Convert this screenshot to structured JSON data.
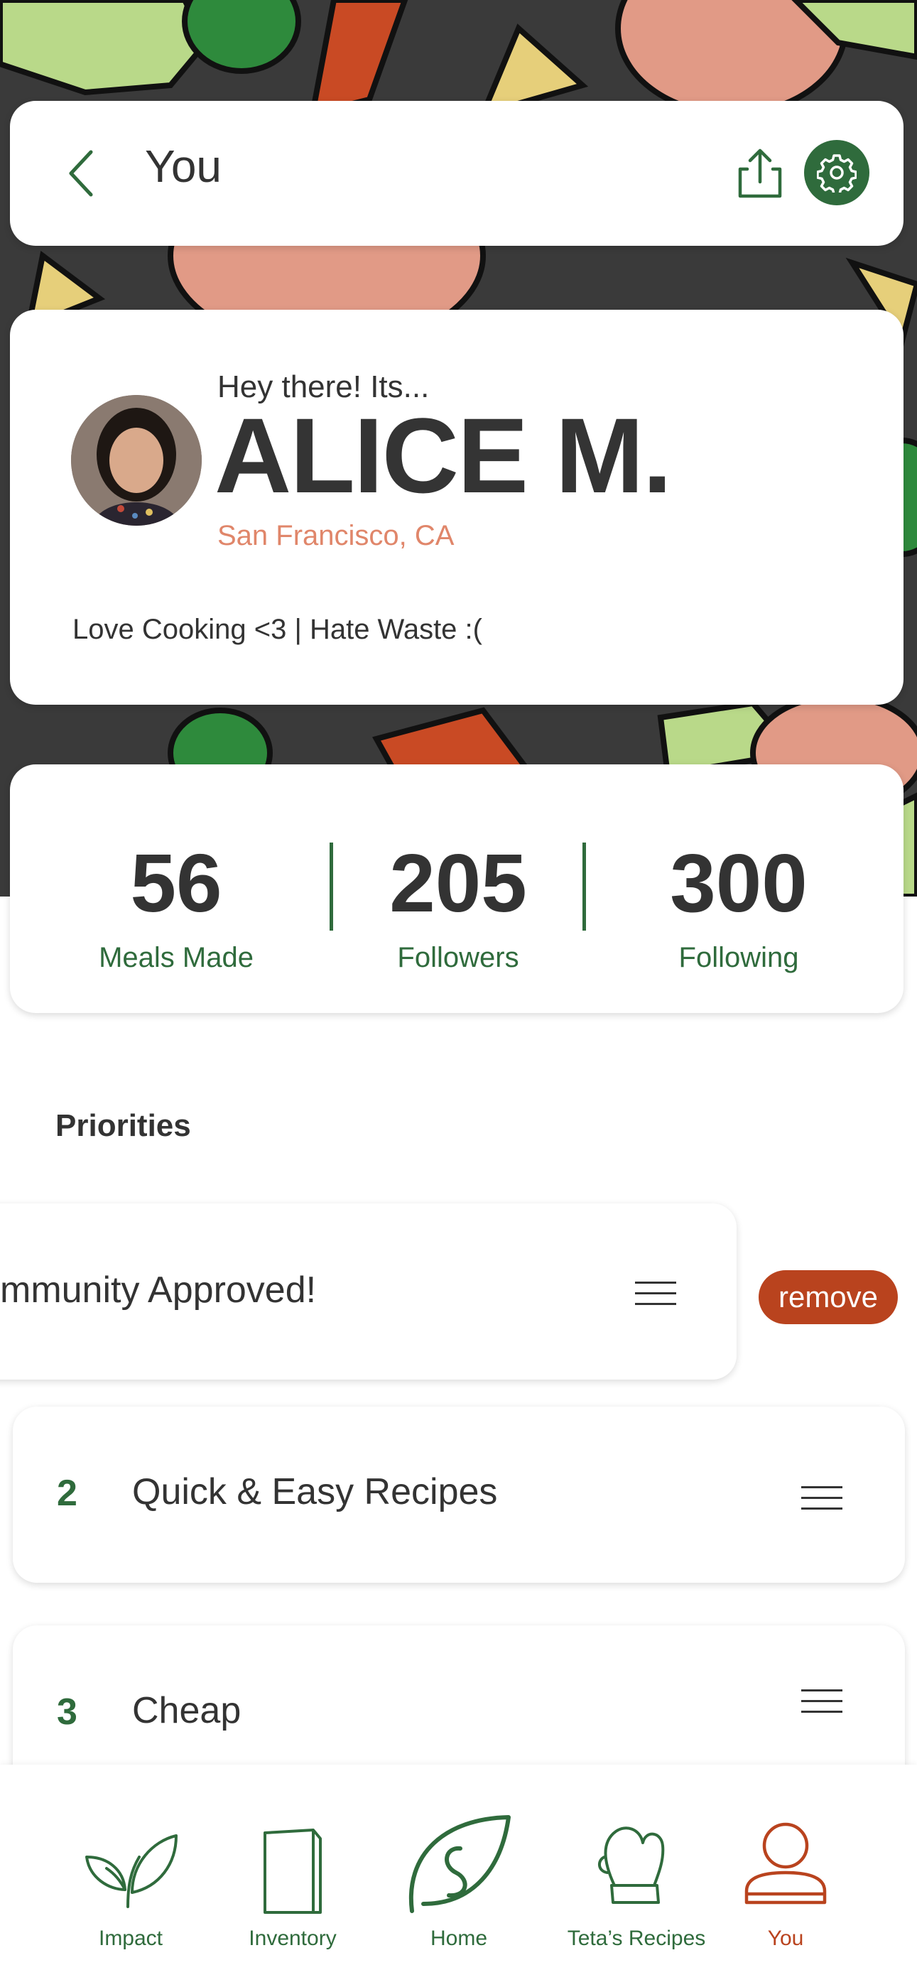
{
  "colors": {
    "brand_green": "#2f6b3c",
    "accent_orange": "#e0866a",
    "remove_red": "#b9431e",
    "hero_bg": "#3a3a3a"
  },
  "header": {
    "title": "You",
    "back_icon": "chevron-left-icon",
    "share_icon": "share-icon",
    "settings_icon": "gear-icon"
  },
  "profile": {
    "greeting": "Hey there! Its...",
    "name": "ALICE M.",
    "location": "San Francisco, CA",
    "bio": "Love Cooking <3 | Hate Waste :("
  },
  "stats": [
    {
      "value": "56",
      "label": "Meals Made"
    },
    {
      "value": "205",
      "label": "Followers"
    },
    {
      "value": "300",
      "label": "Following"
    }
  ],
  "priorities": {
    "title": "Priorities",
    "items": [
      {
        "number": "",
        "label": "mmunity Approved!"
      },
      {
        "number": "2",
        "label": "Quick & Easy Recipes"
      },
      {
        "number": "3",
        "label": "Cheap"
      }
    ],
    "remove_label": "remove"
  },
  "nav": {
    "items": [
      {
        "label": "Impact",
        "icon": "sprout-icon"
      },
      {
        "label": "Inventory",
        "icon": "fridge-icon"
      },
      {
        "label": "Home",
        "icon": "leaf-icon"
      },
      {
        "label": "Teta’s Recipes",
        "icon": "oven-mitt-icon"
      },
      {
        "label": "You",
        "icon": "user-icon"
      }
    ],
    "active": "You"
  }
}
